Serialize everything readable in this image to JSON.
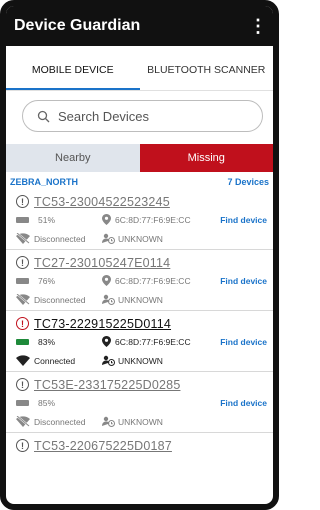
{
  "app": {
    "title": "Device Guardian"
  },
  "tabs": [
    {
      "label": "MOBILE DEVICE",
      "active": true
    },
    {
      "label": "BLUETOOTH SCANNER",
      "active": false
    }
  ],
  "search": {
    "placeholder": "Search Devices"
  },
  "segments": {
    "nearby": "Nearby",
    "missing": "Missing",
    "selected": "Missing"
  },
  "group": {
    "name": "ZEBRA_NORTH",
    "count": "7 Devices"
  },
  "colors": {
    "accent": "#1a73c9",
    "missing": "#c0101c",
    "battery_connected": "#1e8a3a"
  },
  "devices": [
    {
      "name": "TC53-23004522523245",
      "battery": "51%",
      "mac": "6C:8D:77:F6:9E:CC",
      "status": "Disconnected",
      "user": "UNKNOWN",
      "action": "Find device"
    },
    {
      "name": "TC27-230105247E0114",
      "battery": "76%",
      "mac": "6C:8D:77:F6:9E:CC",
      "status": "Disconnected",
      "user": "UNKNOWN",
      "action": "Find device"
    },
    {
      "name": "TC73-222915225D0114",
      "battery": "83%",
      "mac": "6C:8D:77:F6:9E:CC",
      "status": "Connected",
      "user": "UNKNOWN",
      "action": "Find device"
    },
    {
      "name": "TC53E-233175225D0285",
      "battery": "85%",
      "mac": "",
      "status": "Disconnected",
      "user": "UNKNOWN",
      "action": "Find device"
    },
    {
      "name": "TC53-220675225D0187"
    }
  ]
}
